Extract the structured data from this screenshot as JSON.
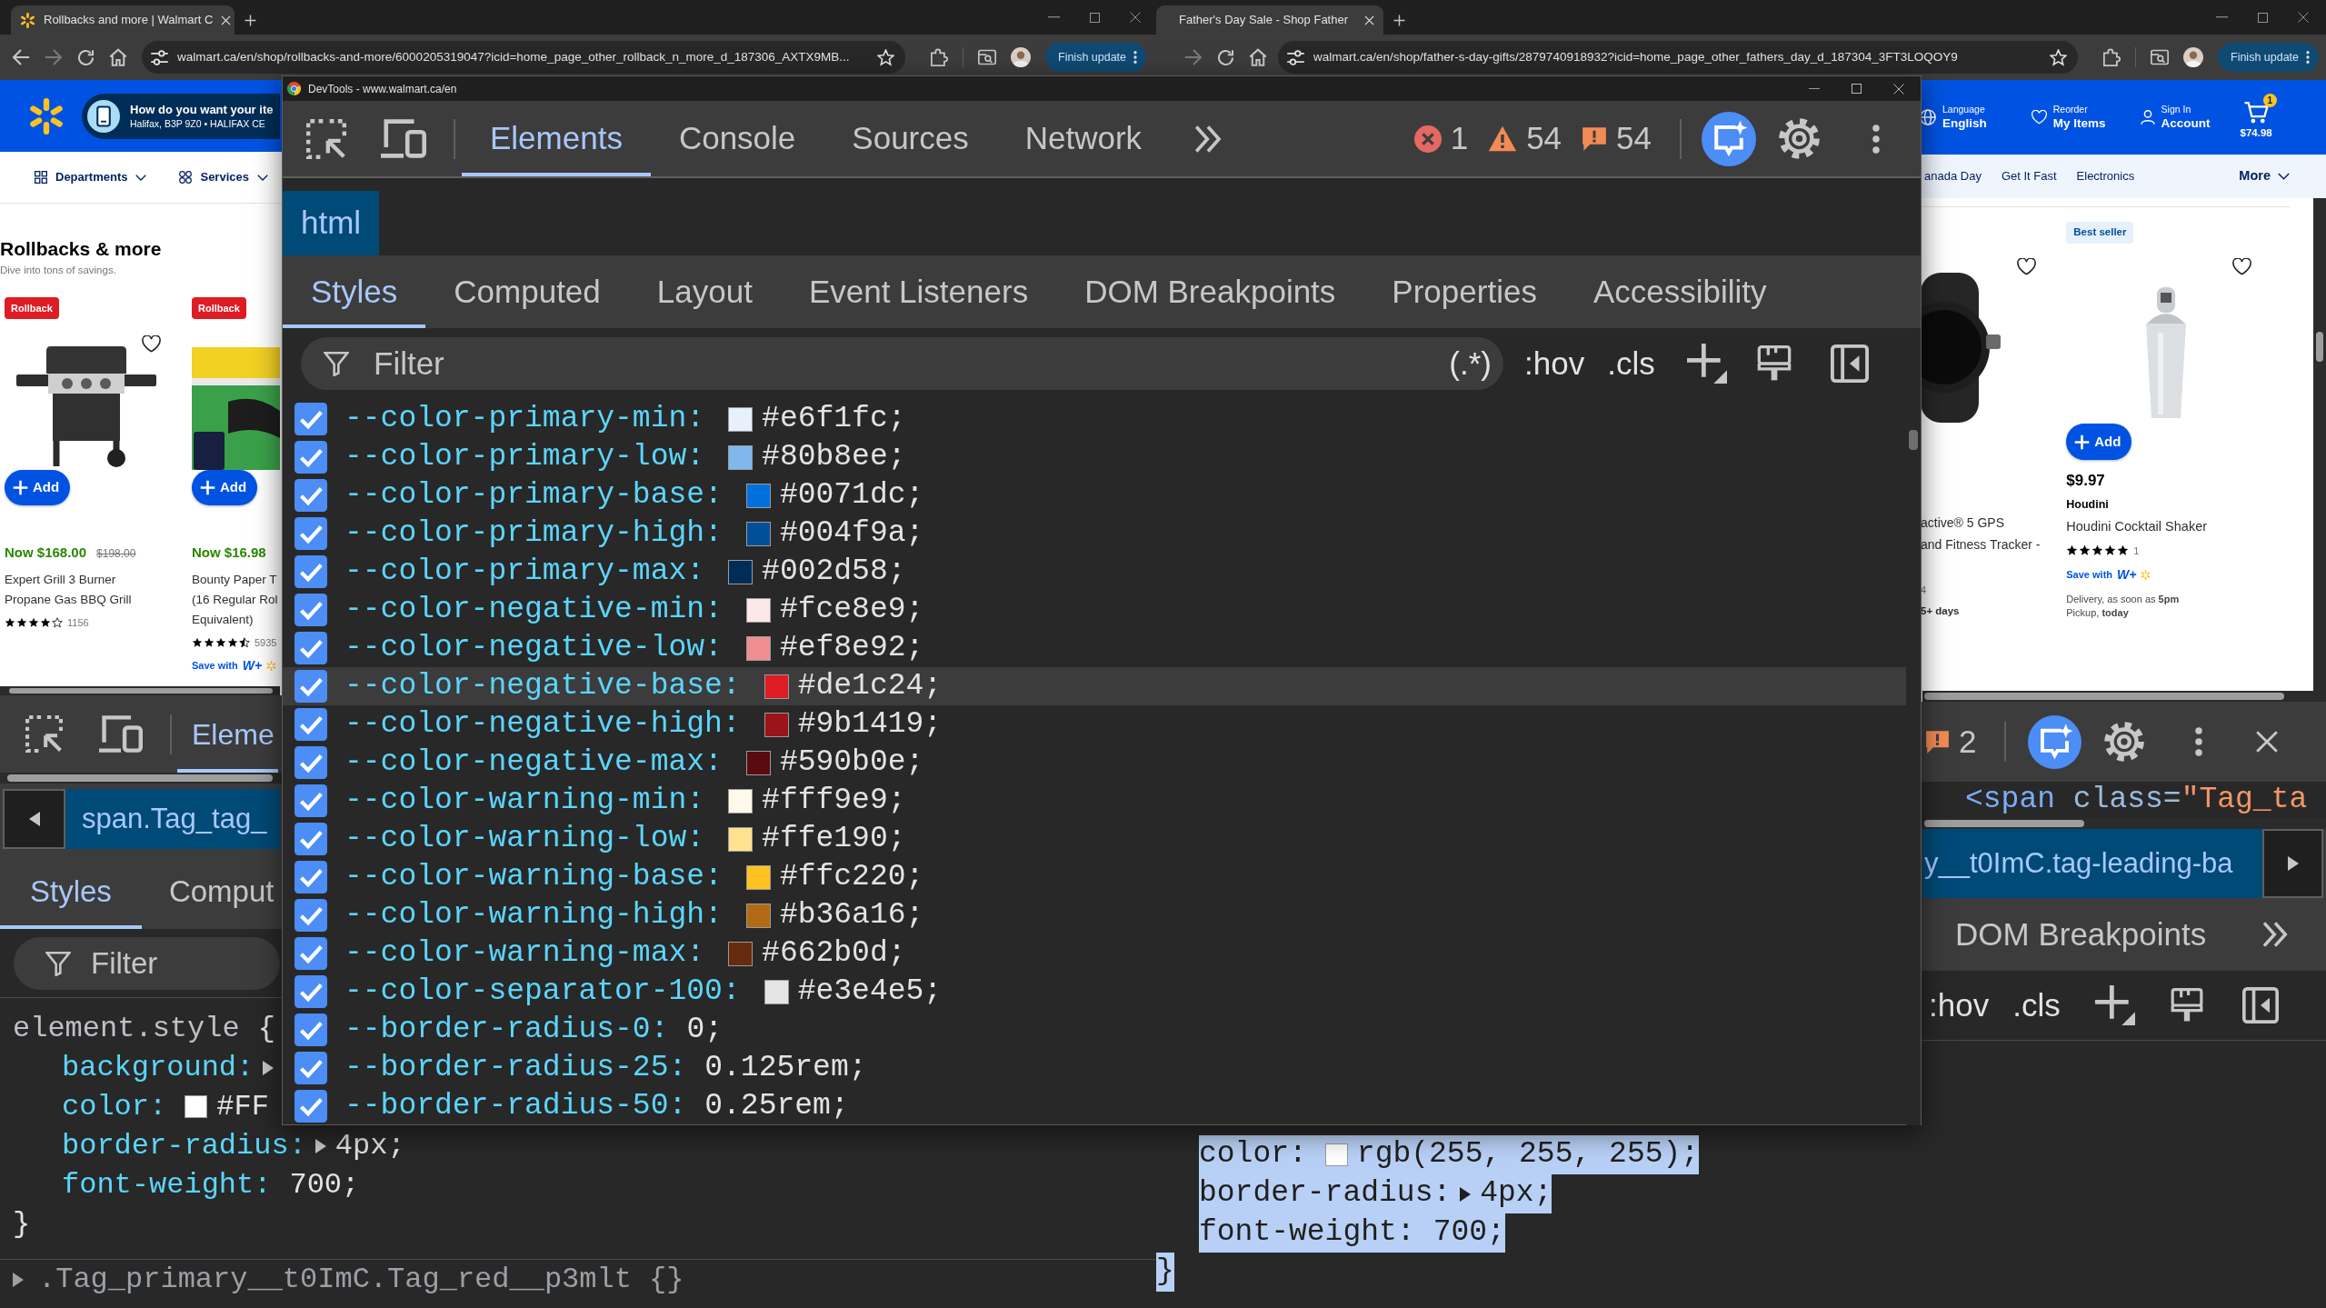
{
  "left_browser": {
    "tab_title": "Rollbacks and more | Walmart C",
    "url": "walmart.ca/en/shop/rollbacks-and-more/6000205319047?icid=home_page_other_rollback_n_more_d_187306_AXTX9MB...",
    "update_button": "Finish update",
    "location": {
      "title": "How do you want your ite",
      "detail": "Halifax, B3P 9Z0 • HALIFAX CE"
    },
    "nav": [
      {
        "kind": "departments",
        "label": "Departments"
      },
      {
        "kind": "services",
        "label": "Services"
      }
    ],
    "section": {
      "title": "Rollbacks & more",
      "subtitle": "Dive into tons of savings."
    },
    "products": [
      {
        "tag": {
          "kind": "rollback",
          "label": "Rollback"
        },
        "favorite": false,
        "add_button": "Add",
        "price": {
          "kind": "sale",
          "text": "Now $168.00"
        },
        "old_price": "$198.00",
        "title": "Expert Grill 3 Burner\nPropane Gas BBQ Grill",
        "stars": 4,
        "reviews": "1156"
      },
      {
        "tag": {
          "kind": "rollback",
          "label": "Rollback"
        },
        "add_button": "Add",
        "price": {
          "kind": "sale",
          "text": "Now $16.98"
        },
        "title": "Bounty Paper T\n(16 Regular Rol\nEquivalent)",
        "stars": 4.5,
        "reviews": "5935",
        "member_offer": {
          "label": "Save with",
          "logo": "W+"
        }
      }
    ],
    "devtools": {
      "tabs": [
        {
          "label": "Eleme",
          "selected": true
        }
      ],
      "breadcrumb": {
        "label": "span.Tag_tag_",
        "selected": true
      },
      "panel_tabs": [
        {
          "label": "Styles",
          "selected": true
        },
        {
          "label": "Comput",
          "selected": false
        }
      ],
      "filter_placeholder": "Filter",
      "code": [
        {
          "kind": "selector",
          "selector": "element.style",
          "brace": "{"
        },
        {
          "kind": "declaration",
          "property": "background:",
          "expander": true
        },
        {
          "kind": "declaration",
          "property": "color:",
          "color": "#ffffff",
          "value": "#FF"
        },
        {
          "kind": "declaration",
          "property": "border-radius:",
          "expander": true,
          "value": "4px;"
        },
        {
          "kind": "declaration",
          "property": "font-weight:",
          "value": "700;"
        },
        {
          "kind": "close",
          "text": "}"
        },
        {
          "kind": "rule",
          "expanded": false,
          "text": ".Tag_primary__t0ImC.Tag_red__p3mlt {}"
        }
      ]
    }
  },
  "right_browser": {
    "tab_title": "Father's Day Sale - Shop Father",
    "url": "walmart.ca/en/shop/father-s-day-gifts/2879740918932?icid=home_page_other_fathers_day_d_187304_3FT3LOQOY9",
    "update_button": "Finish update",
    "header_links": [
      {
        "kind": "language",
        "caption": "Language",
        "label": "English"
      },
      {
        "kind": "reorder",
        "caption": "Reorder",
        "label": "My Items"
      },
      {
        "kind": "account",
        "caption": "Sign In",
        "label": "Account"
      }
    ],
    "cart": {
      "count": "1",
      "total": "$74.98"
    },
    "nav": [
      {
        "label": "anada Day"
      },
      {
        "label": "Get It Fast"
      },
      {
        "label": "Electronics"
      }
    ],
    "nav_more": "More",
    "products": [
      {
        "favorite": false,
        "title": "active® 5 GPS\nand Fitness Tracker -",
        "reviews": "4",
        "delivery_time": "5+ days"
      },
      {
        "tag": {
          "kind": "bestseller",
          "label": "Best seller"
        },
        "favorite": false,
        "add_button": "Add",
        "price": {
          "kind": "regular",
          "text": "$9.97"
        },
        "brand": "Houdini",
        "title": "Houdini Cocktail Shaker",
        "stars": 5,
        "reviews": "1",
        "member_offer": {
          "label": "Save with",
          "logo": "W+"
        },
        "delivery": "Delivery, as soon as **5pm**",
        "pickup": "Pickup, **today**"
      }
    ],
    "devtools": {
      "issues_count": "2",
      "element_line": {
        "tag": "<span",
        "attribute": "class=",
        "attribute_value": "\"Tag_ta"
      },
      "breadcrumb": {
        "label": "y__t0ImC.tag-leading-ba",
        "selected": true
      },
      "panel_tabs": [
        {
          "label": "DOM Breakpoints",
          "selected": false
        }
      ],
      "toolbar_buttons": [
        ":hov",
        ".cls"
      ],
      "code": [
        {
          "kind": "declaration",
          "property": "color:",
          "color": "#ffffff",
          "value": "rgb(255, 255, 255);",
          "selected": true
        },
        {
          "kind": "declaration",
          "property": "border-radius:",
          "expander": true,
          "value": "4px;",
          "selected": true
        },
        {
          "kind": "declaration",
          "property": "font-weight:",
          "value": "700;",
          "selected": true
        },
        {
          "kind": "close",
          "text": "}",
          "selected": true
        }
      ]
    }
  },
  "devtools_window": {
    "title": "DevTools - www.walmart.ca/en",
    "tabs": [
      {
        "label": "Elements",
        "selected": true
      },
      {
        "label": "Console",
        "selected": false
      },
      {
        "label": "Sources",
        "selected": false
      },
      {
        "label": "Network",
        "selected": false
      }
    ],
    "counters": [
      {
        "kind": "error",
        "count": "1"
      },
      {
        "kind": "warning",
        "count": "54"
      },
      {
        "kind": "issue",
        "count": "54"
      }
    ],
    "breadcrumb": {
      "label": "html",
      "selected": true
    },
    "panel_tabs": [
      {
        "label": "Styles",
        "selected": true
      },
      {
        "label": "Computed",
        "selected": false
      },
      {
        "label": "Layout",
        "selected": false
      },
      {
        "label": "Event Listeners",
        "selected": false
      },
      {
        "label": "DOM Breakpoints",
        "selected": false
      },
      {
        "label": "Properties",
        "selected": false
      },
      {
        "label": "Accessibility",
        "selected": false
      }
    ],
    "filter_placeholder": "Filter",
    "regex_button": "(.*)",
    "toolbar_buttons": [
      ":hov",
      ".cls"
    ],
    "properties": [
      {
        "name": "--color-primary-min:",
        "value": "#e6f1fc;",
        "color": "#e6f1fc",
        "checked": true,
        "highlighted": false
      },
      {
        "name": "--color-primary-low:",
        "value": "#80b8ee;",
        "color": "#80b8ee",
        "checked": true,
        "highlighted": false
      },
      {
        "name": "--color-primary-base:",
        "value": "#0071dc;",
        "color": "#0071dc",
        "checked": true,
        "highlighted": false
      },
      {
        "name": "--color-primary-high:",
        "value": "#004f9a;",
        "color": "#004f9a",
        "checked": true,
        "highlighted": false
      },
      {
        "name": "--color-primary-max:",
        "value": "#002d58;",
        "color": "#002d58",
        "checked": true,
        "highlighted": false
      },
      {
        "name": "--color-negative-min:",
        "value": "#fce8e9;",
        "color": "#fce8e9",
        "checked": true,
        "highlighted": false
      },
      {
        "name": "--color-negative-low:",
        "value": "#ef8e92;",
        "color": "#ef8e92",
        "checked": true,
        "highlighted": false
      },
      {
        "name": "--color-negative-base:",
        "value": "#de1c24;",
        "color": "#de1c24",
        "checked": true,
        "highlighted": true
      },
      {
        "name": "--color-negative-high:",
        "value": "#9b1419;",
        "color": "#9b1419",
        "checked": true,
        "highlighted": false
      },
      {
        "name": "--color-negative-max:",
        "value": "#590b0e;",
        "color": "#590b0e",
        "checked": true,
        "highlighted": false
      },
      {
        "name": "--color-warning-min:",
        "value": "#fff9e9;",
        "color": "#fff9e9",
        "checked": true,
        "highlighted": false
      },
      {
        "name": "--color-warning-low:",
        "value": "#ffe190;",
        "color": "#ffe190",
        "checked": true,
        "highlighted": false
      },
      {
        "name": "--color-warning-base:",
        "value": "#ffc220;",
        "color": "#ffc220",
        "checked": true,
        "highlighted": false
      },
      {
        "name": "--color-warning-high:",
        "value": "#b36a16;",
        "color": "#b36a16",
        "checked": true,
        "highlighted": false
      },
      {
        "name": "--color-warning-max:",
        "value": "#662b0d;",
        "color": "#662b0d",
        "checked": true,
        "highlighted": false
      },
      {
        "name": "--color-separator-100:",
        "value": "#e3e4e5;",
        "color": "#e3e4e5",
        "checked": true,
        "highlighted": false
      },
      {
        "name": "--border-radius-0:",
        "value": "0;",
        "checked": true,
        "highlighted": false
      },
      {
        "name": "--border-radius-25:",
        "value": "0.125rem;",
        "checked": true,
        "highlighted": false
      },
      {
        "name": "--border-radius-50:",
        "value": "0.25rem;",
        "checked": true,
        "highlighted": false
      }
    ]
  }
}
